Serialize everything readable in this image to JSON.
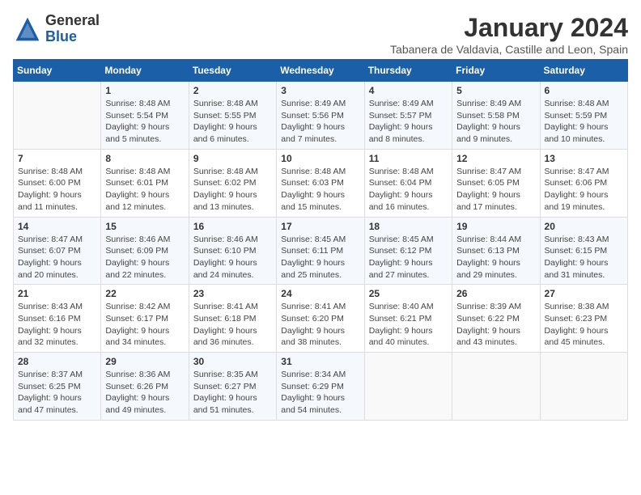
{
  "header": {
    "logo_general": "General",
    "logo_blue": "Blue",
    "month_title": "January 2024",
    "subtitle": "Tabanera de Valdavia, Castille and Leon, Spain"
  },
  "days_of_week": [
    "Sunday",
    "Monday",
    "Tuesday",
    "Wednesday",
    "Thursday",
    "Friday",
    "Saturday"
  ],
  "weeks": [
    [
      {
        "day": "",
        "info": ""
      },
      {
        "day": "1",
        "info": "Sunrise: 8:48 AM\nSunset: 5:54 PM\nDaylight: 9 hours\nand 5 minutes."
      },
      {
        "day": "2",
        "info": "Sunrise: 8:48 AM\nSunset: 5:55 PM\nDaylight: 9 hours\nand 6 minutes."
      },
      {
        "day": "3",
        "info": "Sunrise: 8:49 AM\nSunset: 5:56 PM\nDaylight: 9 hours\nand 7 minutes."
      },
      {
        "day": "4",
        "info": "Sunrise: 8:49 AM\nSunset: 5:57 PM\nDaylight: 9 hours\nand 8 minutes."
      },
      {
        "day": "5",
        "info": "Sunrise: 8:49 AM\nSunset: 5:58 PM\nDaylight: 9 hours\nand 9 minutes."
      },
      {
        "day": "6",
        "info": "Sunrise: 8:48 AM\nSunset: 5:59 PM\nDaylight: 9 hours\nand 10 minutes."
      }
    ],
    [
      {
        "day": "7",
        "info": "Sunrise: 8:48 AM\nSunset: 6:00 PM\nDaylight: 9 hours\nand 11 minutes."
      },
      {
        "day": "8",
        "info": "Sunrise: 8:48 AM\nSunset: 6:01 PM\nDaylight: 9 hours\nand 12 minutes."
      },
      {
        "day": "9",
        "info": "Sunrise: 8:48 AM\nSunset: 6:02 PM\nDaylight: 9 hours\nand 13 minutes."
      },
      {
        "day": "10",
        "info": "Sunrise: 8:48 AM\nSunset: 6:03 PM\nDaylight: 9 hours\nand 15 minutes."
      },
      {
        "day": "11",
        "info": "Sunrise: 8:48 AM\nSunset: 6:04 PM\nDaylight: 9 hours\nand 16 minutes."
      },
      {
        "day": "12",
        "info": "Sunrise: 8:47 AM\nSunset: 6:05 PM\nDaylight: 9 hours\nand 17 minutes."
      },
      {
        "day": "13",
        "info": "Sunrise: 8:47 AM\nSunset: 6:06 PM\nDaylight: 9 hours\nand 19 minutes."
      }
    ],
    [
      {
        "day": "14",
        "info": "Sunrise: 8:47 AM\nSunset: 6:07 PM\nDaylight: 9 hours\nand 20 minutes."
      },
      {
        "day": "15",
        "info": "Sunrise: 8:46 AM\nSunset: 6:09 PM\nDaylight: 9 hours\nand 22 minutes."
      },
      {
        "day": "16",
        "info": "Sunrise: 8:46 AM\nSunset: 6:10 PM\nDaylight: 9 hours\nand 24 minutes."
      },
      {
        "day": "17",
        "info": "Sunrise: 8:45 AM\nSunset: 6:11 PM\nDaylight: 9 hours\nand 25 minutes."
      },
      {
        "day": "18",
        "info": "Sunrise: 8:45 AM\nSunset: 6:12 PM\nDaylight: 9 hours\nand 27 minutes."
      },
      {
        "day": "19",
        "info": "Sunrise: 8:44 AM\nSunset: 6:13 PM\nDaylight: 9 hours\nand 29 minutes."
      },
      {
        "day": "20",
        "info": "Sunrise: 8:43 AM\nSunset: 6:15 PM\nDaylight: 9 hours\nand 31 minutes."
      }
    ],
    [
      {
        "day": "21",
        "info": "Sunrise: 8:43 AM\nSunset: 6:16 PM\nDaylight: 9 hours\nand 32 minutes."
      },
      {
        "day": "22",
        "info": "Sunrise: 8:42 AM\nSunset: 6:17 PM\nDaylight: 9 hours\nand 34 minutes."
      },
      {
        "day": "23",
        "info": "Sunrise: 8:41 AM\nSunset: 6:18 PM\nDaylight: 9 hours\nand 36 minutes."
      },
      {
        "day": "24",
        "info": "Sunrise: 8:41 AM\nSunset: 6:20 PM\nDaylight: 9 hours\nand 38 minutes."
      },
      {
        "day": "25",
        "info": "Sunrise: 8:40 AM\nSunset: 6:21 PM\nDaylight: 9 hours\nand 40 minutes."
      },
      {
        "day": "26",
        "info": "Sunrise: 8:39 AM\nSunset: 6:22 PM\nDaylight: 9 hours\nand 43 minutes."
      },
      {
        "day": "27",
        "info": "Sunrise: 8:38 AM\nSunset: 6:23 PM\nDaylight: 9 hours\nand 45 minutes."
      }
    ],
    [
      {
        "day": "28",
        "info": "Sunrise: 8:37 AM\nSunset: 6:25 PM\nDaylight: 9 hours\nand 47 minutes."
      },
      {
        "day": "29",
        "info": "Sunrise: 8:36 AM\nSunset: 6:26 PM\nDaylight: 9 hours\nand 49 minutes."
      },
      {
        "day": "30",
        "info": "Sunrise: 8:35 AM\nSunset: 6:27 PM\nDaylight: 9 hours\nand 51 minutes."
      },
      {
        "day": "31",
        "info": "Sunrise: 8:34 AM\nSunset: 6:29 PM\nDaylight: 9 hours\nand 54 minutes."
      },
      {
        "day": "",
        "info": ""
      },
      {
        "day": "",
        "info": ""
      },
      {
        "day": "",
        "info": ""
      }
    ]
  ]
}
